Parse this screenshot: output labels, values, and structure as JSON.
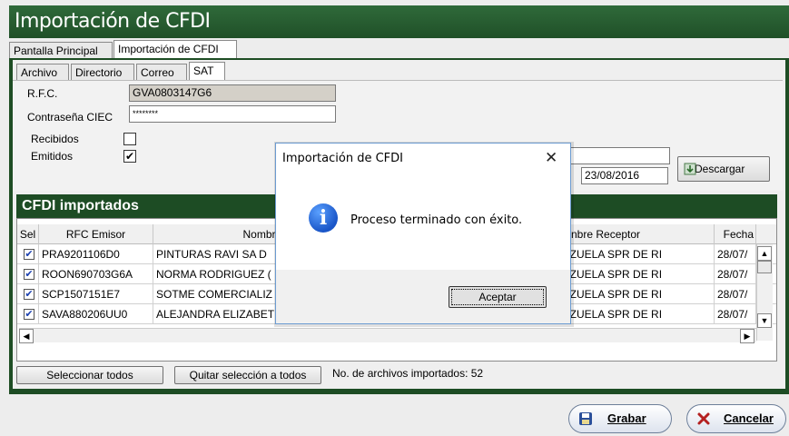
{
  "window": {
    "title": "Importación de CFDI"
  },
  "outer_tabs": [
    "Pantalla Principal",
    "Importación de CFDI"
  ],
  "inner_tabs": [
    "Archivo",
    "Directorio",
    "Correo",
    "SAT"
  ],
  "sat_form": {
    "rfc_label": "R.F.C.",
    "rfc_value": "GVA0803147G6",
    "ciec_label": "Contraseña CIEC",
    "ciec_value": "********",
    "recibidos_label": "Recibidos",
    "emitidos_label": "Emitidos",
    "recibidos_checked": "",
    "emitidos_checked": "✔",
    "date_end": "23/08/2016",
    "download_label": "Descargar"
  },
  "cfdi": {
    "header": "CFDI importados",
    "columns": [
      "Sel",
      "RFC Emisor",
      "Nombre E",
      "",
      "nbre Receptor",
      "Fecha"
    ],
    "rows": [
      {
        "rfc": "PRA9201106D0",
        "nombre": "PINTURAS RAVI SA D",
        "receptor": "NZUELA SPR DE RI",
        "fecha": "28/07/"
      },
      {
        "rfc": "ROON690703G6A",
        "nombre": "NORMA RODRIGUEZ (",
        "receptor": "NZUELA SPR DE RI",
        "fecha": "28/07/"
      },
      {
        "rfc": "SCP1507151E7",
        "nombre": "SOTME COMERCIALIZ",
        "receptor": "NZUELA SPR DE RI",
        "fecha": "28/07/"
      },
      {
        "rfc": "SAVA880206UU0",
        "nombre": "ALEJANDRA ELIZABET",
        "receptor": "NZUELA SPR DE RI",
        "fecha": "28/07/"
      }
    ],
    "check": "✔"
  },
  "actions": {
    "select_all": "Seleccionar todos",
    "deselect_all": "Quitar selección a todos",
    "count_text": "No. de archivos importados: 52"
  },
  "footer": {
    "save": "Grabar",
    "cancel": "Cancelar"
  },
  "dialog": {
    "title": "Importación de CFDI",
    "close": "✕",
    "message": "Proceso terminado con éxito.",
    "ok": "Aceptar",
    "icon": "i"
  },
  "colors": {
    "brand_green": "#1d4c24",
    "title_green": "#2f6a3a",
    "info_blue": "#1a56c8"
  }
}
